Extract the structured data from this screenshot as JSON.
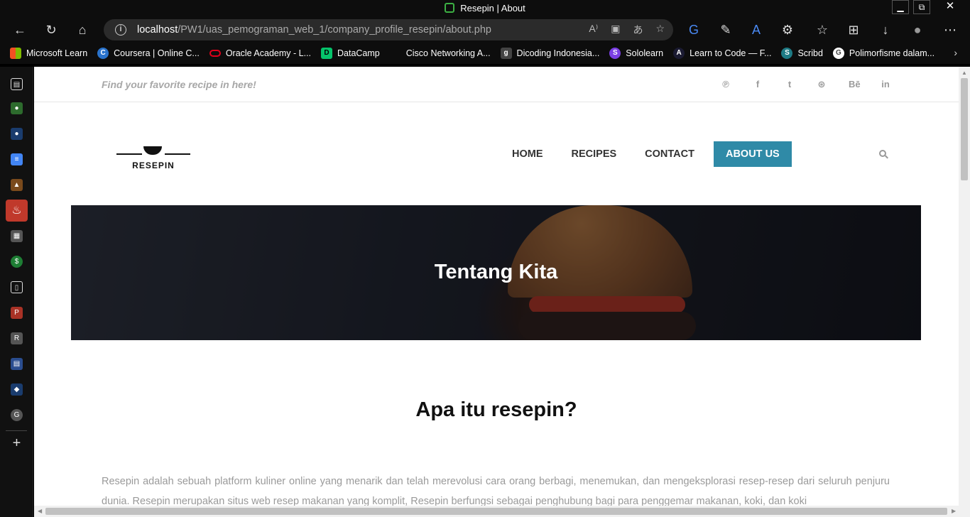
{
  "window": {
    "title": "Resepin | About",
    "controls": {
      "minimize": "▁",
      "restore": "⧉",
      "close": "✕"
    }
  },
  "toolbar": {
    "back": "←",
    "refresh": "↻",
    "home": "⌂",
    "info": "i",
    "url_host": "localhost",
    "url_path": "/PW1/uas_pemograman_web_1/company_profile_resepin/about.php",
    "address_icons": {
      "read_aloud": "A⁾",
      "reader": "▣",
      "translate": "あ",
      "favorite": "☆"
    },
    "right_icons": {
      "extension_translate": "G",
      "extension_pen": "✎",
      "extension_text": "A",
      "extensions": "⚙",
      "favorites": "☆",
      "collections": "⊞",
      "downloads": "↓",
      "profile": "●",
      "menu": "⋯"
    }
  },
  "bookmarks": {
    "items": [
      {
        "label": "Microsoft Learn",
        "icon": "ms",
        "color": "#f25022"
      },
      {
        "label": "Coursera | Online C...",
        "icon": "C",
        "color": "#2a73cc"
      },
      {
        "label": "Oracle Academy - L...",
        "icon": "O",
        "color": "#e0001b"
      },
      {
        "label": "DataCamp",
        "icon": "D",
        "color": "#05c46b"
      },
      {
        "label": "Cisco Networking A...",
        "icon": "",
        "color": "#0d0d0d"
      },
      {
        "label": "Dicoding Indonesia...",
        "icon": "g",
        "color": "#444"
      },
      {
        "label": "Sololearn",
        "icon": "S",
        "color": "#7b3fe4"
      },
      {
        "label": "Learn to Code — F...",
        "icon": "A",
        "color": "#1b1b32"
      },
      {
        "label": "Scribd",
        "icon": "S",
        "color": "#1e7b85"
      },
      {
        "label": "Polimorfisme dalam...",
        "icon": "G",
        "color": "#666"
      }
    ],
    "more": "›"
  },
  "sidebar": {
    "icons": [
      {
        "name": "tab-actions-icon",
        "glyph": "▤",
        "color": "#111"
      },
      {
        "name": "app-green-icon",
        "glyph": "●",
        "color": "#2d6b2d"
      },
      {
        "name": "app-blue-icon",
        "glyph": "●",
        "color": "#1a3c6e"
      },
      {
        "name": "google-docs-icon",
        "glyph": "≡",
        "color": "#4285f4"
      },
      {
        "name": "app-mountain-icon",
        "glyph": "▲",
        "color": "#7a4a1c"
      },
      {
        "name": "resepin-app-icon",
        "glyph": "♨",
        "color": "#c0392b"
      },
      {
        "name": "app-gray-icon",
        "glyph": "▦",
        "color": "#555"
      },
      {
        "name": "app-money-icon",
        "glyph": "$",
        "color": "#1e7e34"
      },
      {
        "name": "document-icon",
        "glyph": "▯",
        "color": "#111"
      },
      {
        "name": "pdf-icon",
        "glyph": "P",
        "color": "#a93226"
      },
      {
        "name": "researchgate-icon",
        "glyph": "R",
        "color": "#555"
      },
      {
        "name": "file-icon",
        "glyph": "▤",
        "color": "#2a4d8f"
      },
      {
        "name": "app-drop-icon",
        "glyph": "◆",
        "color": "#1a3c6e"
      },
      {
        "name": "google-icon",
        "glyph": "G",
        "color": "#555"
      }
    ],
    "add": "+"
  },
  "page": {
    "tagline": "Find your favorite recipe in here!",
    "social": [
      "℗",
      "f",
      "t",
      "⊛",
      "Bē",
      "in"
    ],
    "logo_text": "RESEPIN",
    "nav": [
      {
        "label": "HOME",
        "active": false
      },
      {
        "label": "RECIPES",
        "active": false
      },
      {
        "label": "CONTACT",
        "active": false
      },
      {
        "label": "ABOUT US",
        "active": true
      }
    ],
    "hero_title": "Tentang Kita",
    "section_title": "Apa itu resepin?",
    "body_text": "Resepin adalah sebuah platform kuliner online yang menarik dan telah merevolusi cara orang berbagi, menemukan, dan mengeksplorasi resep-resep dari seluruh penjuru dunia. Resepin merupakan situs web resep makanan yang komplit, Resepin berfungsi sebagai penghubung bagi para penggemar makanan, koki, dan koki"
  },
  "colors": {
    "accent": "#2f8aa7",
    "text_muted": "#9a9a9a"
  }
}
